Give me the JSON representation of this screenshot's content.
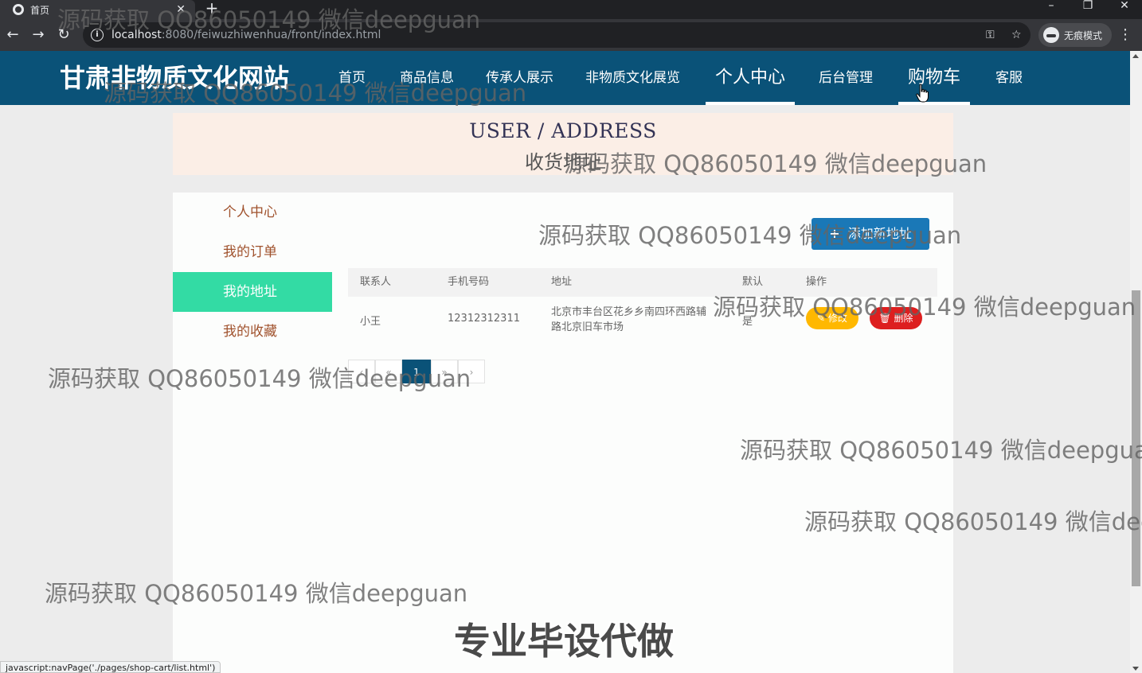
{
  "browser": {
    "tab_title": "首页",
    "url_host": "localhost",
    "url_rest": ":8080/feiwuzhiwenhua/front/index.html",
    "incognito_label": "无痕模式",
    "status_text": "javascript:navPage('./pages/shop-cart/list.html')"
  },
  "header": {
    "brand": "甘肃非物质文化网站",
    "nav": [
      {
        "label": "首页"
      },
      {
        "label": "商品信息"
      },
      {
        "label": "传承人展示"
      },
      {
        "label": "非物质文化展览"
      },
      {
        "label": "个人中心"
      },
      {
        "label": "后台管理"
      },
      {
        "label": "购物车"
      },
      {
        "label": "客服"
      }
    ]
  },
  "banner": {
    "en": "USER / ADDRESS",
    "cn": "收货地址"
  },
  "sidebar": {
    "items": [
      {
        "label": "个人中心"
      },
      {
        "label": "我的订单"
      },
      {
        "label": "我的地址"
      },
      {
        "label": "我的收藏"
      }
    ]
  },
  "toolbar": {
    "add_label": "添加新地址"
  },
  "table": {
    "columns": [
      "联系人",
      "手机号码",
      "地址",
      "默认",
      "操作"
    ],
    "rows": [
      {
        "name": "小王",
        "phone": "12312312311",
        "address_line1": "北京市丰台区花乡乡南四环西路辅",
        "address_line2": "路北京旧车市场",
        "default": "是",
        "edit_label": "修改",
        "delete_label": "删除"
      }
    ]
  },
  "pagination": {
    "current": "1"
  },
  "watermark": {
    "text": "源码获取 QQ86050149 微信deepguan",
    "ad": "专业毕设代做"
  },
  "colors": {
    "header_bg": "#0a5278",
    "sidebar_active": "#33dba4",
    "add_button": "#1a78b7",
    "edit_button": "#ffb800",
    "delete_button": "#dd1f1f",
    "banner_bg": "#fbeee6"
  }
}
